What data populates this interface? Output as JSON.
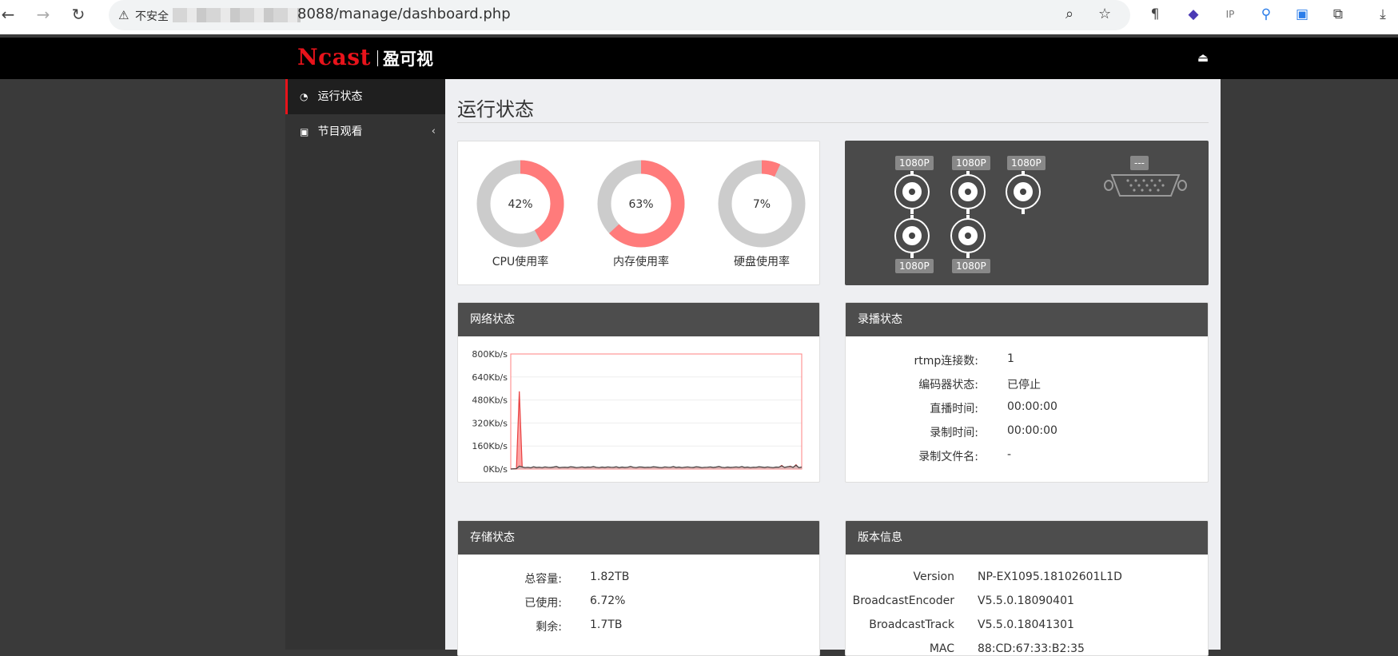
{
  "browser": {
    "insecure_label": "不安全",
    "url": "8088/manage/dashboard.php"
  },
  "header": {
    "logo_brand": "Ncast",
    "logo_cn": "盈可视"
  },
  "sidebar": {
    "items": [
      {
        "label": "运行状态",
        "icon": "dashboard-icon",
        "active": true
      },
      {
        "label": "节目观看",
        "icon": "play-square-icon",
        "active": false
      }
    ]
  },
  "main": {
    "page_title": "运行状态",
    "gauges": [
      {
        "label": "CPU使用率",
        "value_text": "42%",
        "value": 42
      },
      {
        "label": "内存使用率",
        "value_text": "63%",
        "value": 63
      },
      {
        "label": "硬盘使用率",
        "value_text": "7%",
        "value": 7
      }
    ],
    "ports": {
      "top_labels": [
        "1080P",
        "1080P",
        "1080P"
      ],
      "bottom_labels": [
        "1080P",
        "1080P"
      ],
      "vga_label": "---"
    },
    "network": {
      "title": "网络状态"
    },
    "recording": {
      "title": "录播状态",
      "rows": [
        {
          "key": "rtmp连接数:",
          "value": "1"
        },
        {
          "key": "编码器状态:",
          "value": "已停止"
        },
        {
          "key": "直播时间:",
          "value": "00:00:00"
        },
        {
          "key": "录制时间:",
          "value": "00:00:00"
        },
        {
          "key": "录制文件名:",
          "value": "-"
        }
      ]
    },
    "storage": {
      "title": "存储状态",
      "rows": [
        {
          "key": "总容量:",
          "value": "1.82TB"
        },
        {
          "key": "已使用:",
          "value": "6.72%"
        },
        {
          "key": "剩余:",
          "value": "1.7TB"
        }
      ]
    },
    "version": {
      "title": "版本信息",
      "rows": [
        {
          "key": "Version",
          "value": "NP-EX1095.18102601L1D"
        },
        {
          "key": "BroadcastEncoder",
          "value": "V5.5.0.18090401"
        },
        {
          "key": "BroadcastTrack",
          "value": "V5.5.0.18041301"
        },
        {
          "key": "MAC",
          "value": "88:CD:67:33:B2:35"
        }
      ]
    }
  },
  "colors": {
    "accent": "#e8131b",
    "gauge_fill": "#ff7b7b",
    "gauge_track": "#cccccc",
    "panel_head": "#4d4d4d"
  },
  "chart_data": {
    "type": "area",
    "ylabel": "",
    "ylim": [
      0,
      800
    ],
    "y_ticks": [
      "0Kb/s",
      "160Kb/s",
      "320Kb/s",
      "480Kb/s",
      "640Kb/s",
      "800Kb/s"
    ],
    "grid": true,
    "series": [
      {
        "values": [
          0,
          2,
          3,
          540,
          12,
          8,
          10,
          7,
          14,
          9,
          11,
          8,
          13,
          10,
          9,
          12,
          16,
          8,
          10,
          11,
          9,
          14,
          12,
          8,
          10,
          13,
          9,
          12,
          11,
          15,
          10,
          8,
          12,
          9,
          13,
          11,
          10,
          14,
          8,
          12,
          9,
          11,
          16,
          10,
          8,
          13,
          12,
          9,
          11,
          10,
          14,
          12,
          9,
          8,
          13,
          11,
          10,
          15,
          9,
          12,
          8,
          11,
          13,
          10,
          9,
          14,
          12,
          8,
          10,
          11,
          13,
          9,
          12,
          16,
          10,
          8,
          12,
          9,
          11,
          13,
          10,
          15,
          9,
          12,
          8,
          11,
          10,
          14,
          12,
          9,
          13,
          10,
          8,
          12,
          11,
          25,
          9,
          14,
          20,
          10,
          30,
          8,
          12
        ]
      },
      {
        "values": [
          0,
          1,
          2,
          20,
          15,
          10,
          12,
          9,
          16,
          11,
          13,
          10,
          15,
          12,
          11,
          14,
          18,
          10,
          12,
          13,
          11,
          16,
          14,
          10,
          12,
          15,
          11,
          14,
          13,
          17,
          12,
          10,
          14,
          11,
          15,
          13,
          12,
          16,
          10,
          14,
          11,
          13,
          18,
          12,
          10,
          15,
          14,
          11,
          13,
          12,
          16,
          14,
          11,
          10,
          15,
          13,
          12,
          17,
          11,
          14,
          10,
          13,
          15,
          12,
          11,
          16,
          14,
          10,
          12,
          13,
          15,
          11,
          14,
          18,
          12,
          10,
          14,
          11,
          13,
          15,
          12,
          17,
          11,
          14,
          10,
          13,
          12,
          16,
          14,
          11,
          15,
          12,
          10,
          14,
          13,
          22,
          11,
          16,
          18,
          12,
          26,
          10,
          14
        ]
      }
    ]
  }
}
